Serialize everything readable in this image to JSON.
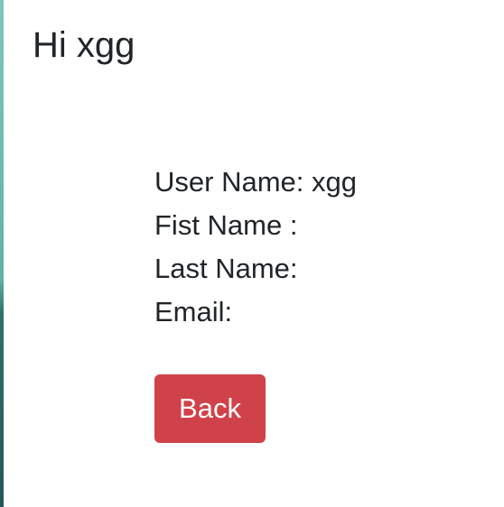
{
  "greeting": "Hi xgg",
  "details": {
    "user_name": "User Name: xgg",
    "first_name": "Fist Name :",
    "last_name": "Last Name:",
    "email": "Email:"
  },
  "actions": {
    "back_label": "Back"
  },
  "colors": {
    "back_button": "#d0424a",
    "text": "#212529",
    "background": "#ffffff"
  }
}
